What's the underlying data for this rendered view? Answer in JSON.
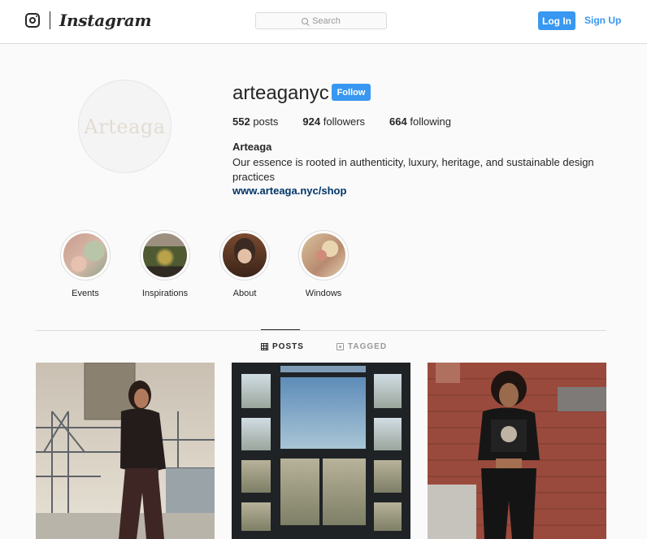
{
  "header": {
    "brand": "Instagram",
    "search_placeholder": "Search",
    "login_label": "Log In",
    "signup_label": "Sign Up"
  },
  "profile": {
    "avatar_text": "Arteaga",
    "username": "arteaganyc",
    "follow_label": "Follow",
    "stats": {
      "posts_count": "552",
      "posts_label": "posts",
      "followers_count": "924",
      "followers_label": "followers",
      "following_count": "664",
      "following_label": "following"
    },
    "full_name": "Arteaga",
    "bio": "Our essence is rooted in authenticity, luxury, heritage, and sustainable design practices",
    "website": "www.arteaga.nyc/shop"
  },
  "highlights": [
    {
      "label": "Events"
    },
    {
      "label": "Inspirations"
    },
    {
      "label": "About"
    },
    {
      "label": "Windows"
    }
  ],
  "tabs": {
    "posts": "POSTS",
    "tagged": "TAGGED"
  },
  "colors": {
    "accent": "#3897f0",
    "link": "#003569",
    "border": "#dbdbdb"
  }
}
